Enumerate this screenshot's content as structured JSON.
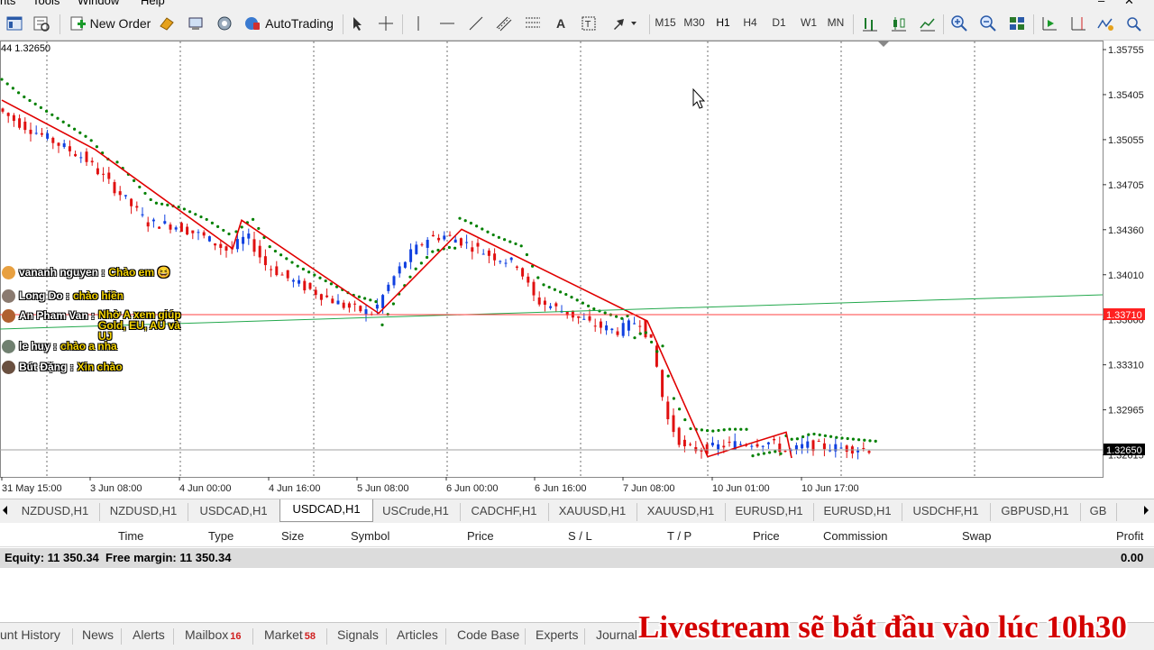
{
  "menu": {
    "items": [
      "nts",
      "Tools",
      "Window",
      "Help"
    ]
  },
  "toolbar": {
    "new_order": "New Order",
    "autotrading": "AutoTrading",
    "timeframes": [
      "M15",
      "M30",
      "H1",
      "H4",
      "D1",
      "W1",
      "MN"
    ],
    "active_timeframe": "H1"
  },
  "chart": {
    "info": "44 1.32650",
    "price_labels": [
      "1.35755",
      "1.35405",
      "1.35055",
      "1.34705",
      "1.34360",
      "1.34010",
      "1.33660",
      "1.33310",
      "1.32965",
      "1.32615"
    ],
    "current_price_label": "1.32650",
    "red_line_label": "1.33710",
    "time_labels": [
      "31 May 15:00",
      "3 Jun 08:00",
      "4 Jun 00:00",
      "4 Jun 16:00",
      "5 Jun 08:00",
      "6 Jun 00:00",
      "6 Jun 16:00",
      "7 Jun 08:00",
      "10 Jun 01:00",
      "10 Jun 17:00"
    ],
    "colors": {
      "bull": "#1040e0",
      "bear": "#e01010",
      "psar": "#008000",
      "zigzag": "#e00000",
      "trendline": "#22a84c",
      "hline": "#ff4040",
      "priceline": "#a0a0a0"
    }
  },
  "chat": [
    {
      "name": "vananh nguyen :",
      "msg": "Chào em 😆",
      "avatar": "#e8a040"
    },
    {
      "name": "Long Do :",
      "msg": "chào hiền",
      "avatar": "#8a7a70"
    },
    {
      "name": "An Pham Van :",
      "msg": "Nhờ A xem giúp Gold, EU, AU và UJ",
      "avatar": "#b06030"
    },
    {
      "name": "le huy :",
      "msg": "chào a nha",
      "avatar": "#708070"
    },
    {
      "name": "Bút Đặng :",
      "msg": "Xin chào",
      "avatar": "#6a5040"
    }
  ],
  "symbol_tabs": [
    "NZDUSD,H1",
    "NZDUSD,H1",
    "USDCAD,H1",
    "USDCAD,H1",
    "USCrude,H1",
    "CADCHF,H1",
    "XAUUSD,H1",
    "XAUUSD,H1",
    "EURUSD,H1",
    "EURUSD,H1",
    "USDCHF,H1",
    "GBPUSD,H1",
    "GB"
  ],
  "active_symbol_tab": 3,
  "terminal": {
    "columns": [
      "Time",
      "Type",
      "Size",
      "Symbol",
      "Price",
      "S / L",
      "T / P",
      "Price",
      "Commission",
      "Swap",
      "Profit"
    ],
    "equity_text": "Equity: 11 350.34  Free margin: 11 350.34",
    "profit": "0.00"
  },
  "bottom_tabs": [
    {
      "label": "unt History"
    },
    {
      "label": "News"
    },
    {
      "label": "Alerts"
    },
    {
      "label": "Mailbox",
      "badge": "16"
    },
    {
      "label": "Market",
      "badge": "58"
    },
    {
      "label": "Signals"
    },
    {
      "label": "Articles"
    },
    {
      "label": "Code Base"
    },
    {
      "label": "Experts"
    },
    {
      "label": "Journal"
    }
  ],
  "overlay": {
    "livestream": "Livestream sẽ bắt đầu vào lúc 10h30"
  }
}
